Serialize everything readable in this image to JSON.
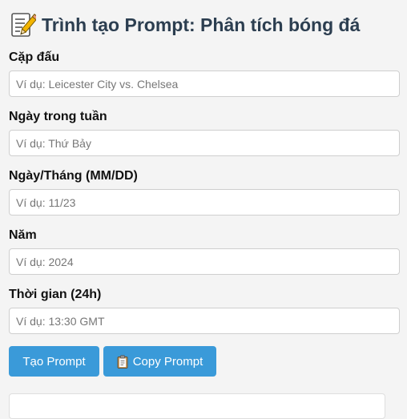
{
  "header": {
    "title": "Trình tạo Prompt: Phân tích bóng đá",
    "icon": "memo-icon"
  },
  "form": {
    "fields": [
      {
        "label": "Cặp đấu",
        "placeholder": "Ví dụ: Leicester City vs. Chelsea",
        "value": ""
      },
      {
        "label": "Ngày trong tuần",
        "placeholder": "Ví dụ: Thứ Bảy",
        "value": ""
      },
      {
        "label": "Ngày/Tháng (MM/DD)",
        "placeholder": "Ví dụ: 11/23",
        "value": ""
      },
      {
        "label": "Năm",
        "placeholder": "Ví dụ: 2024",
        "value": ""
      },
      {
        "label": "Thời gian (24h)",
        "placeholder": "Ví dụ: 13:30 GMT",
        "value": ""
      }
    ]
  },
  "actions": {
    "create_label": "Tạo Prompt",
    "copy_label": "Copy Prompt",
    "copy_icon": "clipboard-icon",
    "accent_color": "#3a9ad9"
  },
  "output": {
    "text": ""
  }
}
